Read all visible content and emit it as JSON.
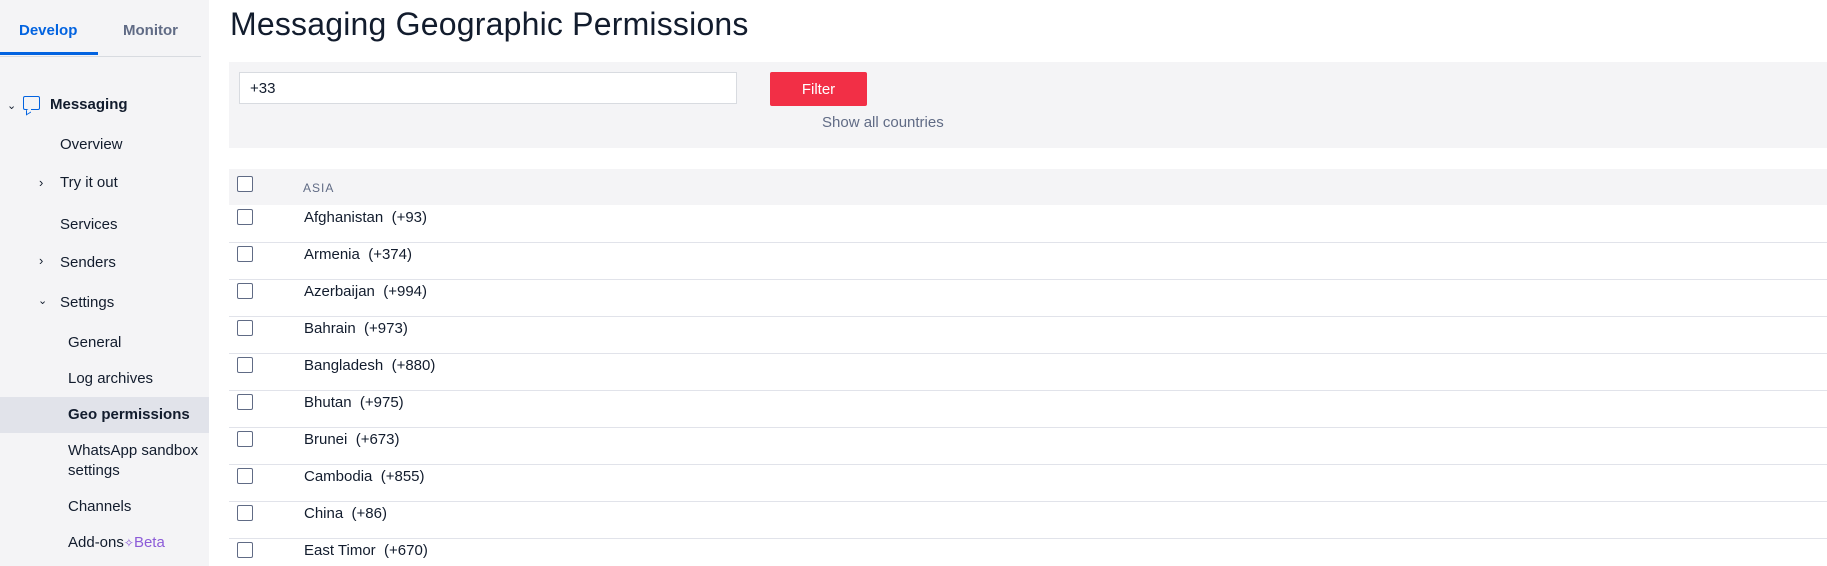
{
  "sidebar": {
    "tabs": [
      "Develop",
      "Monitor"
    ],
    "section": "Messaging",
    "items": {
      "overview": "Overview",
      "try_it_out": "Try it out",
      "services": "Services",
      "senders": "Senders",
      "settings": "Settings",
      "general": "General",
      "log_archives": "Log archives",
      "geo_permissions": "Geo permissions",
      "whatsapp_1": "WhatsApp sandbox",
      "whatsapp_2": "settings",
      "channels": "Channels",
      "addons": "Add-ons",
      "beta": "Beta"
    }
  },
  "page": {
    "title": "Messaging Geographic Permissions"
  },
  "filter": {
    "value": "+33",
    "button": "Filter",
    "show_all": "Show all countries"
  },
  "table": {
    "region": "ASIA",
    "rows": [
      {
        "name": "Afghanistan",
        "code": "(+93)"
      },
      {
        "name": "Armenia",
        "code": "(+374)"
      },
      {
        "name": "Azerbaijan",
        "code": "(+994)"
      },
      {
        "name": "Bahrain",
        "code": "(+973)"
      },
      {
        "name": "Bangladesh",
        "code": "(+880)"
      },
      {
        "name": "Bhutan",
        "code": "(+975)"
      },
      {
        "name": "Brunei",
        "code": "(+673)"
      },
      {
        "name": "Cambodia",
        "code": "(+855)"
      },
      {
        "name": "China",
        "code": "(+86)"
      },
      {
        "name": "East Timor",
        "code": "(+670)"
      }
    ]
  },
  "colors": {
    "accent": "#0263e0",
    "filter_button": "#f22f46",
    "beta": "#8c5bd8"
  }
}
